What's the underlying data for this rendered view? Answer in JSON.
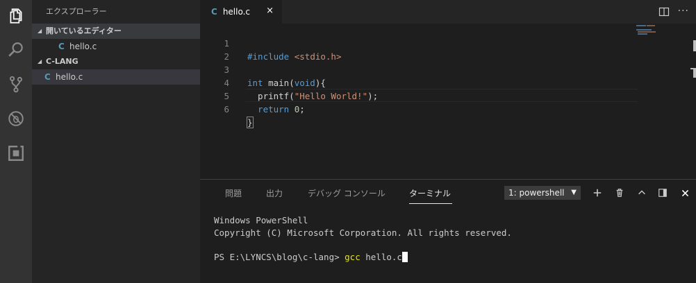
{
  "sidebar": {
    "title": "エクスプローラー",
    "open_editors": {
      "header": "開いているエディター",
      "items": [
        {
          "icon": "C",
          "name": "hello.c"
        }
      ]
    },
    "folder": {
      "header": "C-LANG",
      "items": [
        {
          "icon": "C",
          "name": "hello.c"
        }
      ]
    }
  },
  "editor": {
    "tab": {
      "icon": "C",
      "name": "hello.c",
      "close": "×"
    },
    "line_numbers": [
      "1",
      "2",
      "3",
      "4",
      "5",
      "6"
    ],
    "code": {
      "l1_directive": "#include",
      "l1_header": " <stdio.h>",
      "l3_type": "int",
      "l3_name": " main(",
      "l3_void": "void",
      "l3_close": "){",
      "l4_fn": "  printf(",
      "l4_str": "\"Hello World!\"",
      "l4_end": ");",
      "l5_kw": "  return",
      "l5_num": " 0",
      "l5_end": ";",
      "l6_brace": "}"
    }
  },
  "panel": {
    "tabs": [
      "問題",
      "出力",
      "デバッグ コンソール",
      "ターミナル"
    ],
    "active_tab": "ターミナル",
    "terminal_select": "1: powershell",
    "terminal_lines": {
      "l1": "Windows PowerShell",
      "l2": "Copyright (C) Microsoft Corporation. All rights reserved.",
      "prompt": "PS E:\\LYNCS\\blog\\c-lang> ",
      "command": "gcc",
      "args": " hello.c"
    }
  },
  "colors": {
    "activity_bar": "#333333",
    "sidebar": "#252526",
    "editor": "#1e1e1e",
    "c_icon": "#519aba"
  }
}
